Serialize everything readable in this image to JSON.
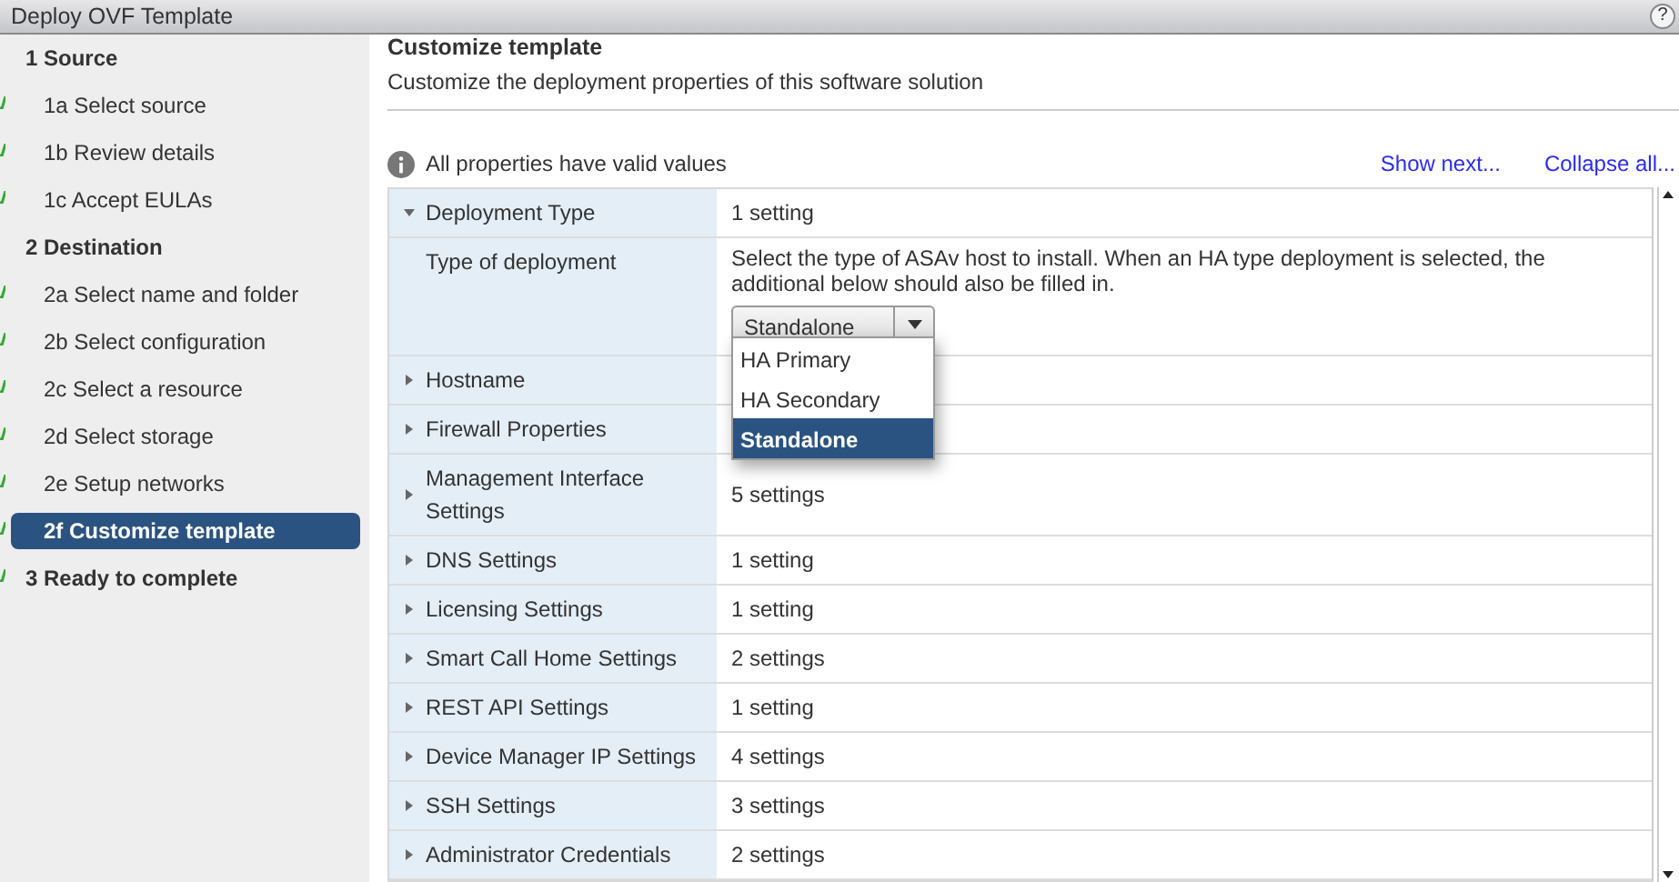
{
  "window": {
    "title": "Deploy OVF Template",
    "help": "?"
  },
  "steps": [
    {
      "number": "1",
      "label": "Source",
      "kind": "section",
      "completed": false,
      "selected": false
    },
    {
      "number": "1a",
      "label": "Select source",
      "kind": "step",
      "completed": true,
      "selected": false
    },
    {
      "number": "1b",
      "label": "Review details",
      "kind": "step",
      "completed": true,
      "selected": false
    },
    {
      "number": "1c",
      "label": "Accept EULAs",
      "kind": "step",
      "completed": true,
      "selected": false
    },
    {
      "number": "2",
      "label": "Destination",
      "kind": "section",
      "completed": false,
      "selected": false
    },
    {
      "number": "2a",
      "label": "Select name and folder",
      "kind": "step",
      "completed": true,
      "selected": false
    },
    {
      "number": "2b",
      "label": "Select configuration",
      "kind": "step",
      "completed": true,
      "selected": false
    },
    {
      "number": "2c",
      "label": "Select a resource",
      "kind": "step",
      "completed": true,
      "selected": false
    },
    {
      "number": "2d",
      "label": "Select storage",
      "kind": "step",
      "completed": true,
      "selected": false
    },
    {
      "number": "2e",
      "label": "Setup networks",
      "kind": "step",
      "completed": true,
      "selected": false
    },
    {
      "number": "2f",
      "label": "Customize template",
      "kind": "step",
      "completed": true,
      "selected": true
    },
    {
      "number": "3",
      "label": "Ready to complete",
      "kind": "section",
      "completed": true,
      "selected": false
    }
  ],
  "page": {
    "title": "Customize template",
    "subtitle": "Customize the deployment properties of this software solution"
  },
  "validation": {
    "message": "All properties have valid values"
  },
  "links": [
    "Show next...",
    "Collapse all..."
  ],
  "properties": [
    {
      "kind": "group",
      "name": "Deployment Type",
      "value": "1 setting",
      "expanded": true
    },
    {
      "kind": "setting",
      "name": "Type of deployment",
      "description": "Select the type of ASAv host to install. When an HA type deployment is selected, the additional below should also be filled in.",
      "select": {
        "value": "Standalone",
        "open": true,
        "options": [
          {
            "label": "HA Primary",
            "selected": false
          },
          {
            "label": "HA Secondary",
            "selected": false
          },
          {
            "label": "Standalone",
            "selected": true
          }
        ]
      }
    },
    {
      "kind": "group",
      "name": "Hostname",
      "expanded": false
    },
    {
      "kind": "group",
      "name": "Firewall Properties",
      "expanded": false
    },
    {
      "kind": "group",
      "name": "Management Interface Settings",
      "value": "5 settings",
      "expanded": false
    },
    {
      "kind": "group",
      "name": "DNS Settings",
      "value": "1 setting",
      "expanded": false
    },
    {
      "kind": "group",
      "name": "Licensing Settings",
      "value": "1 setting",
      "expanded": false
    },
    {
      "kind": "group",
      "name": "Smart Call Home Settings",
      "value": "2 settings",
      "expanded": false
    },
    {
      "kind": "group",
      "name": "REST API Settings",
      "value": "1 setting",
      "expanded": false
    },
    {
      "kind": "group",
      "name": "Device Manager IP Settings",
      "value": "4 settings",
      "expanded": false
    },
    {
      "kind": "group",
      "name": "SSH Settings",
      "value": "3 settings",
      "expanded": false
    },
    {
      "kind": "group",
      "name": "Administrator Credentials",
      "value": "2 settings",
      "expanded": false
    }
  ]
}
